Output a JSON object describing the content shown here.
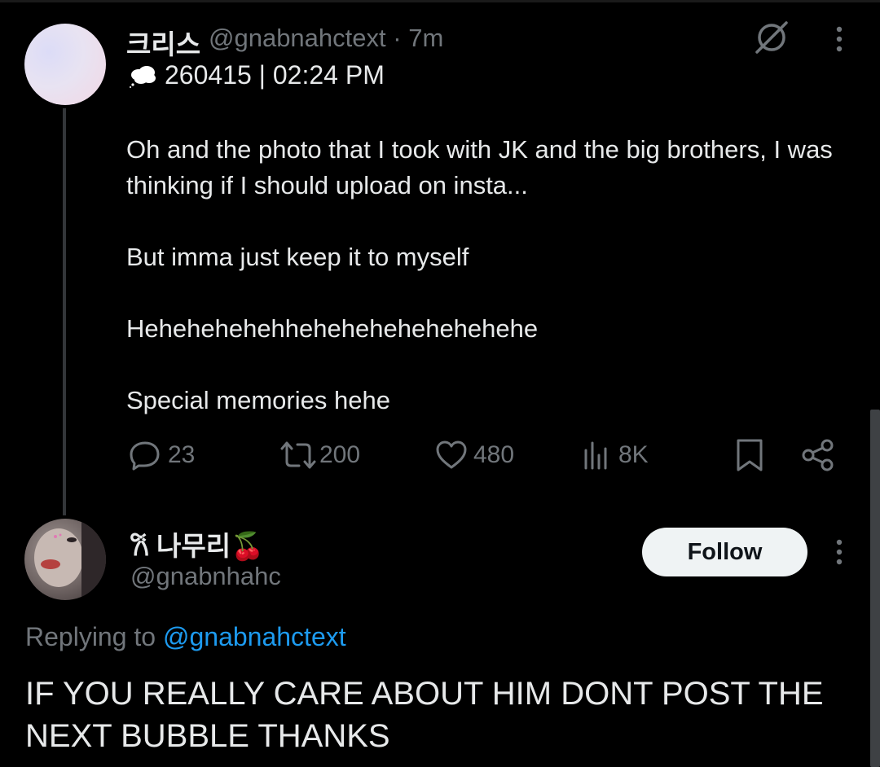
{
  "parent_tweet": {
    "display_name": "크리스",
    "handle": "@gnabnahctext",
    "time_separator": "·",
    "time": "7m",
    "subheader": "260415 | 02:24 PM",
    "body": [
      "Oh and the photo that I took with JK and the big brothers, I was thinking if I should upload on insta...",
      "But imma just keep it to myself",
      "Hehehehehehhehehehehehehehehe",
      "Special memories hehe"
    ],
    "actions": {
      "reply_count": "23",
      "repost_count": "200",
      "like_count": "480",
      "view_count": "8K"
    }
  },
  "reply_tweet": {
    "display_name": "𐙚 나무리🍒",
    "handle": "@gnabnhahc",
    "follow_label": "Follow",
    "replying_prefix": "Replying to",
    "replying_to": "@gnabnahctext",
    "body": "IF YOU REALLY CARE ABOUT HIM DONT POST THE NEXT BUBBLE THANKS"
  },
  "icons": {
    "subheader": "cloud-icon",
    "grok": "grok-icon",
    "more": "more-vertical-icon",
    "reply": "reply-icon",
    "repost": "repost-icon",
    "like": "heart-icon",
    "views": "views-icon",
    "bookmark": "bookmark-icon",
    "share": "share-icon"
  },
  "colors": {
    "background": "#000000",
    "text_primary": "#e7e9ea",
    "text_secondary": "#71767b",
    "link": "#1d9bf0",
    "follow_bg": "#eff3f4"
  }
}
